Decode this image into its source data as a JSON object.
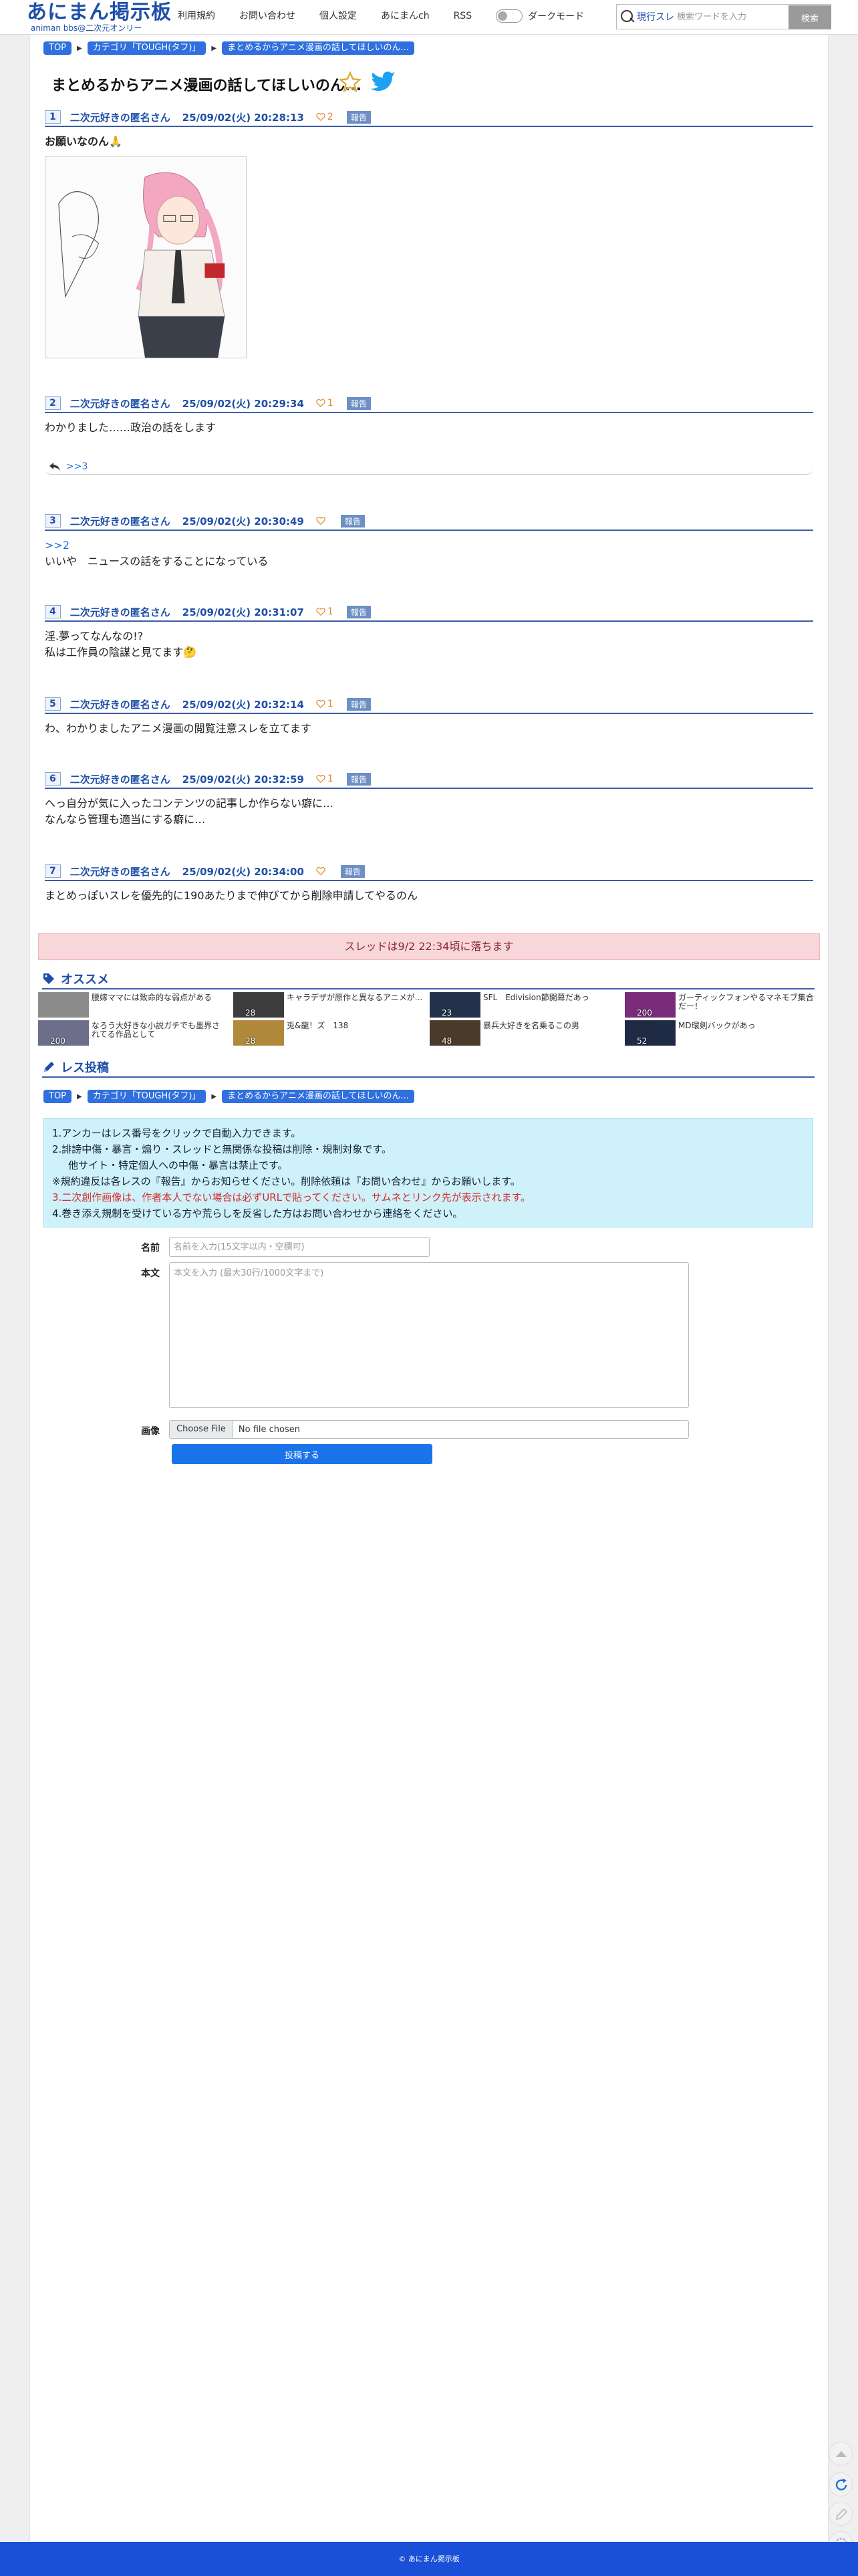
{
  "header": {
    "logo_main": "あにまん掲示板",
    "logo_sub": "animan bbs@二次元オンリー",
    "nav": [
      "利用規約",
      "お問い合わせ",
      "個人設定",
      "あにまんch",
      "RSS"
    ],
    "dark_mode_label": "ダークモード",
    "search_scope": "現行スレ",
    "search_placeholder": "検索ワードを入力",
    "search_button": "検索"
  },
  "breadcrumb": [
    "TOP",
    "カテゴリ「TOUGH(タフ)」",
    "まとめるからアニメ漫画の話してほしいのん..."
  ],
  "thread": {
    "title": "まとめるからアニメ漫画の話してほしいのん..."
  },
  "posts": [
    {
      "num": "1",
      "name": "二次元好きの匿名さん",
      "date": "25/09/02(火) 20:28:13",
      "likes": "2",
      "report": "報告",
      "lines": [
        "お願いなのん🙏"
      ]
    },
    {
      "num": "2",
      "name": "二次元好きの匿名さん",
      "date": "25/09/02(火) 20:29:34",
      "likes": "1",
      "report": "報告",
      "lines": [
        "わかりました……政治の話をします"
      ],
      "reply": ">>3"
    },
    {
      "num": "3",
      "name": "二次元好きの匿名さん",
      "date": "25/09/02(火) 20:30:49",
      "likes": "",
      "report": "報告",
      "anchor": ">>2",
      "lines": [
        "いいや　ニュースの話をすることになっている"
      ]
    },
    {
      "num": "4",
      "name": "二次元好きの匿名さん",
      "date": "25/09/02(火) 20:31:07",
      "likes": "1",
      "report": "報告",
      "lines": [
        "淫.夢ってなんなの!?",
        "私は工作員の陰謀と見てます🤔"
      ]
    },
    {
      "num": "5",
      "name": "二次元好きの匿名さん",
      "date": "25/09/02(火) 20:32:14",
      "likes": "1",
      "report": "報告",
      "lines": [
        "わ、わかりましたアニメ漫画の閲覧注意スレを立てます"
      ]
    },
    {
      "num": "6",
      "name": "二次元好きの匿名さん",
      "date": "25/09/02(火) 20:32:59",
      "likes": "1",
      "report": "報告",
      "lines": [
        "へっ自分が気に入ったコンテンツの記事しか作らない癖に…",
        "なんなら管理も適当にする癖に…"
      ]
    },
    {
      "num": "7",
      "name": "二次元好きの匿名さん",
      "date": "25/09/02(火) 20:34:00",
      "likes": "",
      "report": "報告",
      "lines": [
        "まとめっぽいスレを優先的に190あたりまで伸びてから削除申請してやるのん"
      ]
    }
  ],
  "expire_notice": "スレッドは9/2 22:34頃に落ちます",
  "recommend": {
    "title": "オススメ",
    "items": [
      {
        "text": "腰嫁ママには致命的な弱点がある",
        "count": "",
        "color": "#8c8c8c"
      },
      {
        "text": "キャラデザが原作と異なるアニメが...",
        "count": "28",
        "color": "#3d3d3d"
      },
      {
        "text": "SFL　Edivision節開幕だあっ",
        "count": "23",
        "color": "#23324a"
      },
      {
        "text": "ガーティックフォンやるマネモブ集合だー！",
        "count": "200",
        "color": "#7a2c7a"
      },
      {
        "text": "なろう大好きな小説ガチでも墨界されてる作品として",
        "count": "200",
        "color": "#6b6f8a"
      },
      {
        "text": "兎&龍！ズ　138",
        "count": "28",
        "color": "#b08a3a"
      },
      {
        "text": "暴兵大好きを名乗るこの男",
        "count": "48",
        "color": "#4a3a2a"
      },
      {
        "text": "MD環剣バックがあっ",
        "count": "52",
        "color": "#1f2a44"
      }
    ]
  },
  "post_form": {
    "title": "レス投稿",
    "notice_lines": [
      "1.アンカーはレス番号をクリックで自動入力できます。",
      "2.誹謗中傷・暴言・煽り・スレッドと無関係な投稿は削除・規制対象です。",
      "他サイト・特定個人への中傷・暴言は禁止です。",
      "※規約違反は各レスの『報告』からお知らせください。削除依頼は『お問い合わせ』からお願いします。",
      "3.二次創作画像は、作者本人でない場合は必ずURLで貼ってください。サムネとリンク先が表示されます。",
      "4.巻き添え規制を受けている方や荒らしを反省した方はお問い合わせから連絡をください。"
    ],
    "name_label": "名前",
    "name_placeholder": "名前を入力(15文字以内・空欄可)",
    "body_label": "本文",
    "body_placeholder": "本文を入力 (最大30行/1000文字まで)",
    "image_label": "画像",
    "file_button": "Choose File",
    "file_status": "No file chosen",
    "submit": "投稿する"
  },
  "footer": "© あにまん掲示板",
  "colors": {
    "accent": "#1e4fa8",
    "link": "#1e6fd9",
    "footer": "#1a4fd8"
  }
}
